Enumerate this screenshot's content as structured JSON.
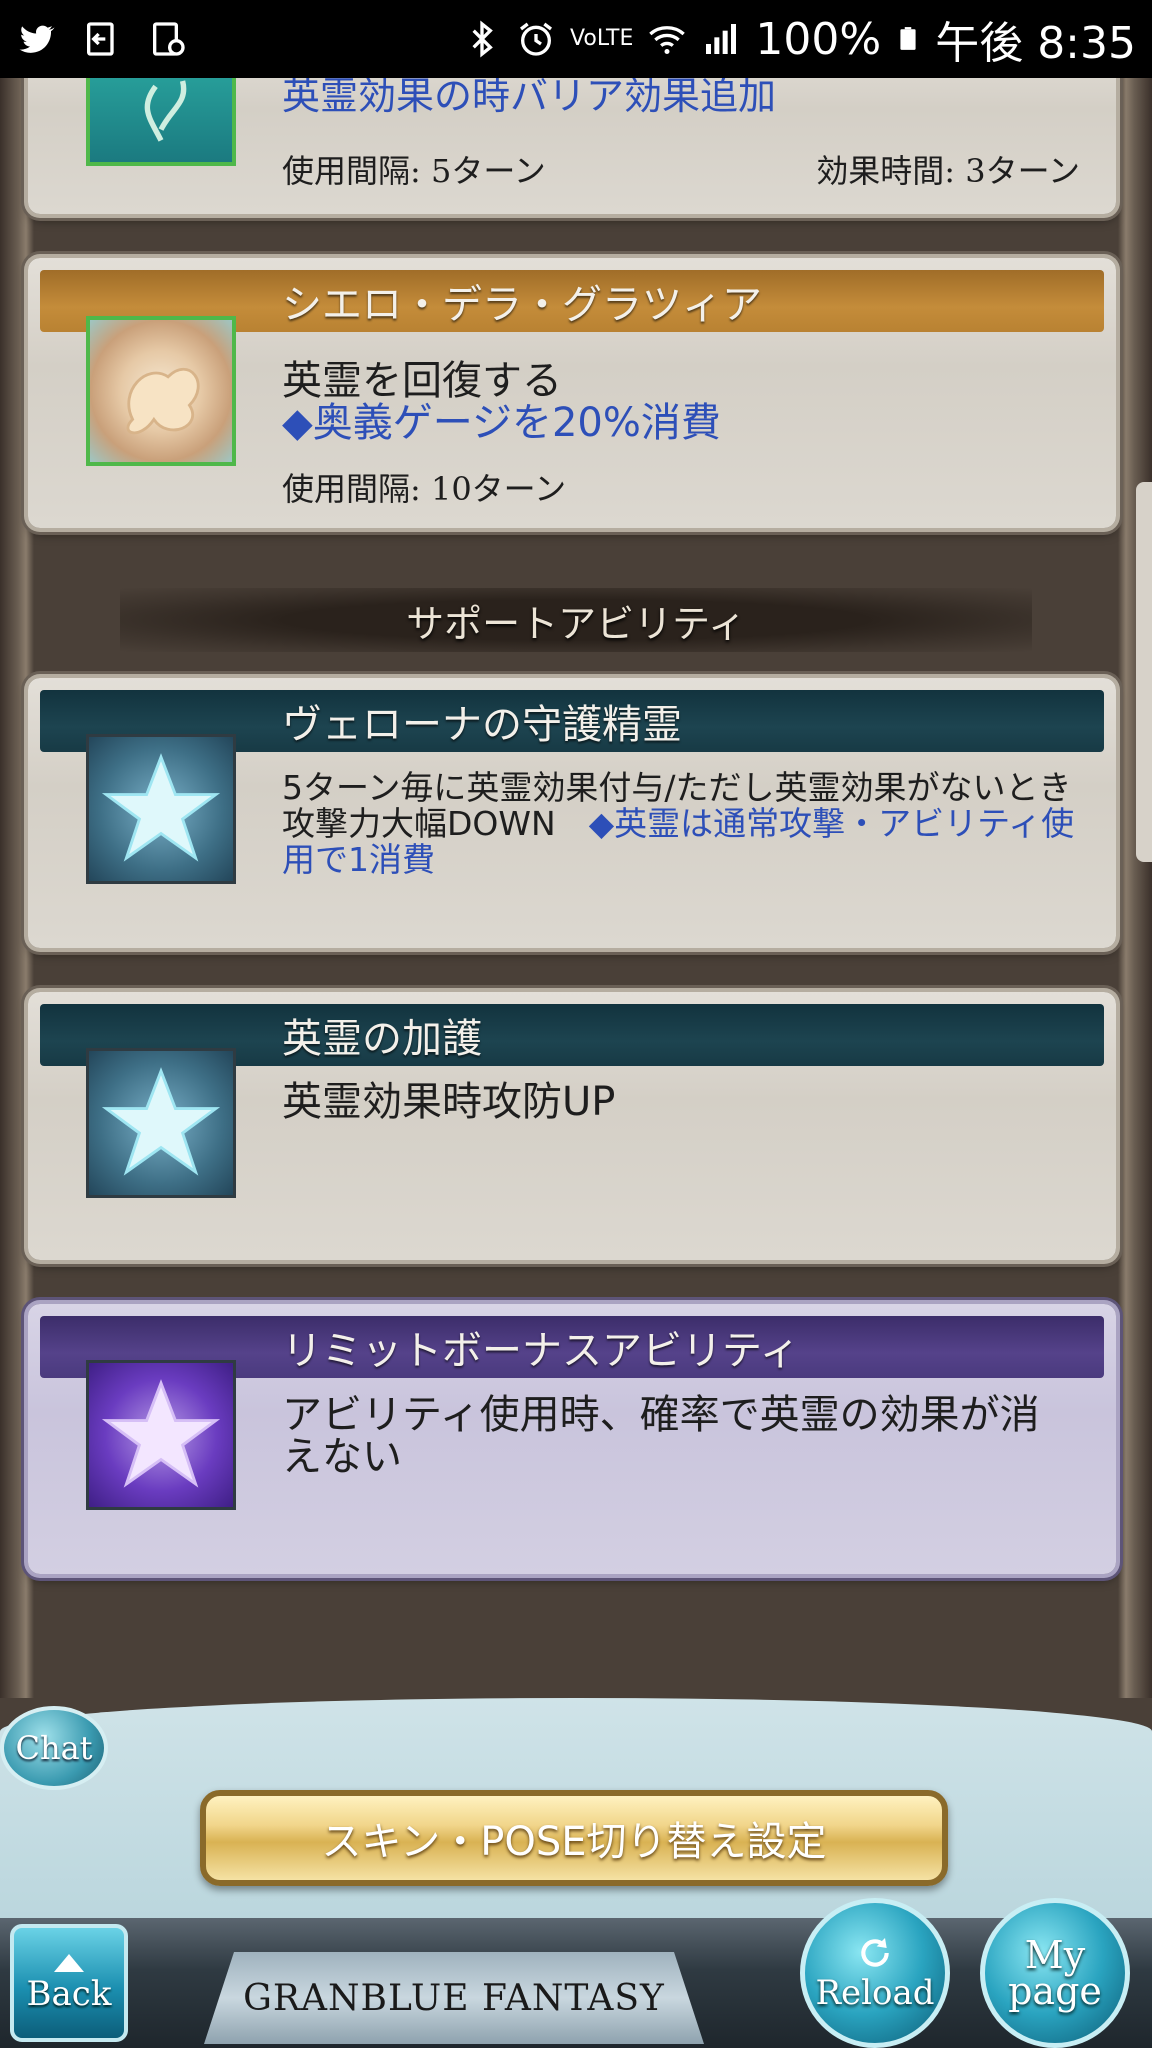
{
  "status_bar": {
    "battery_percent": "100%",
    "clock": "午後 8:35",
    "icons_left": [
      "twitter-icon",
      "sign-in-icon",
      "screenshot-icon"
    ],
    "icons_right": [
      "bluetooth-icon",
      "alarm-icon",
      "volte-icon",
      "wifi-icon",
      "signal-icon",
      "battery-icon"
    ],
    "volte_label": "VoLTE"
  },
  "abilities_top": [
    {
      "title": "",
      "bar_color": "#1d4450",
      "description_blue": "英霊効果の時バリア効果追加",
      "cooldown": "使用間隔: 5ターン",
      "duration": "効果時間: 3ターン"
    },
    {
      "title": "シエロ・デラ・グラツィア",
      "bar_color": "#c48c3a",
      "description": "英霊を回復する",
      "description_blue": "◆奥義ゲージを20%消費",
      "cooldown": "使用間隔: 10ターン"
    }
  ],
  "support_section_title": "サポートアビリティ",
  "support_abilities": [
    {
      "title": "ヴェローナの守護精霊",
      "description": "5ターン毎に英霊効果付与/ただし英霊効果がないとき攻撃力大幅DOWN",
      "description_blue": "◆英霊は通常攻撃・アビリティ使用で1消費"
    },
    {
      "title": "英霊の加護",
      "description": "英霊効果時攻防UP"
    },
    {
      "title": "リミットボーナスアビリティ",
      "description": "アビリティ使用時、確率で英霊の効果が消えない"
    }
  ],
  "chat_label": "Chat",
  "skin_button_label": "スキン・POSE切り替え設定",
  "footer": {
    "back_label": "Back",
    "logo_text": "GRANBLUE FANTASY",
    "reload_label": "Reload",
    "mypage_label_1": "My",
    "mypage_label_2": "page"
  },
  "colors": {
    "accent_blue_text": "#2d4fb8",
    "orange_bar": "#c48c3a",
    "teal_bar": "#1d4450",
    "purple_bar": "#55428a"
  }
}
